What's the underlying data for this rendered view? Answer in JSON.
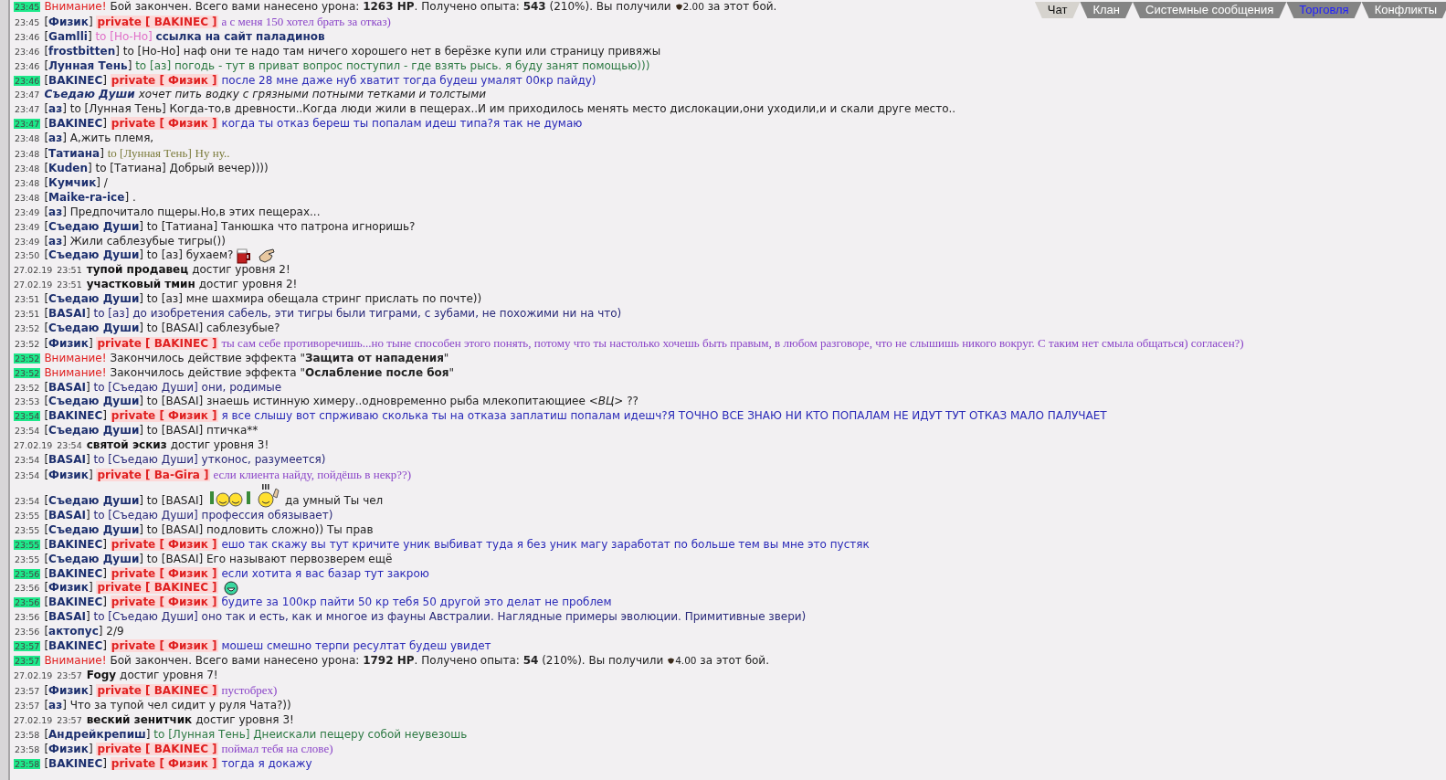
{
  "tabs": [
    {
      "label": "Чат",
      "selected": true,
      "unread": false
    },
    {
      "label": "Клан",
      "selected": false,
      "unread": false
    },
    {
      "label": "Системные сообщения",
      "selected": false,
      "unread": false
    },
    {
      "label": "Торговля",
      "selected": false,
      "unread": true
    },
    {
      "label": "Конфликты",
      "selected": false,
      "unread": false
    }
  ],
  "messages": [
    {
      "kind": "alert",
      "time": "23:45",
      "highlighted": true,
      "label": "Внимание!",
      "text": "Бой закончен. Всего вами нанесено урона: **1263 HP**. Получено опыта: **543** (210%). Вы получили",
      "amount": "2.00",
      "tail": "за этот бой."
    },
    {
      "kind": "private",
      "time": "23:45",
      "highlighted": false,
      "sender": "[**Физик**]",
      "to": "private [ BAKINEC ]",
      "ornate": true,
      "text": "а с меня 150 хотел брать за отказ)",
      "color": "#8a44c8"
    },
    {
      "kind": "chat",
      "time": "23:46",
      "highlighted": false,
      "sender": "[**Gamlli**]",
      "to": {
        "label": "to [Но-Но]",
        "color": "#e070c8"
      },
      "text": "**ссылка на сайт паладинов**",
      "color": "#1c2f6e"
    },
    {
      "kind": "chat",
      "time": "23:46",
      "highlighted": false,
      "sender": "[**frostbitten**]",
      "to": "to [Но-Но]",
      "text": "наф они те надо там ничего хорошего нет в берёзке купи или страницу привяжы",
      "color": "#222222"
    },
    {
      "kind": "chat",
      "time": "23:46",
      "highlighted": false,
      "sender": "[**Лунная Тень**]",
      "to": "to [аз]",
      "text": "погодь - тут в приват вопрос поступил - где взять рысь. я буду занят помощью)))",
      "color": "#2e7a44"
    },
    {
      "kind": "private",
      "time": "23:46",
      "highlighted": true,
      "sender": "[**BAKINEC**]",
      "to": "private [ Физик ]",
      "text": "после 28 мне даже нуб хватит тогда будеш умалят 00кр пайду)",
      "color": "#2a2ab8"
    },
    {
      "kind": "action",
      "time": "23:47",
      "highlighted": false,
      "name": "Съедаю Души",
      "text": "хочет пить водку с грязными потными тетками и толстыми"
    },
    {
      "kind": "chat",
      "time": "23:47",
      "highlighted": false,
      "sender": "[**аз**]",
      "to": "to [Лунная Тень]",
      "text": "Когда-то,в древности..Когда люди жили в пещерах..И им приходилось менять место дислокации,они уходили,и и скали друге место..",
      "color": "#222222"
    },
    {
      "kind": "private",
      "time": "23:47",
      "highlighted": true,
      "sender": "[**BAKINEC**]",
      "to": "private [ Физик ]",
      "text": "когда ты отказ береш ты попалам идеш типа?я так не думаю",
      "color": "#2a2ab8"
    },
    {
      "kind": "chat",
      "time": "23:48",
      "highlighted": false,
      "sender": "[**аз**]",
      "text": "А,жить племя,",
      "color": "#222222"
    },
    {
      "kind": "chat",
      "time": "23:48",
      "highlighted": false,
      "sender": "[**Татиана**]",
      "to": "to [Лунная Тень]",
      "ornate": true,
      "text": "Ну ну..",
      "color": "#7a7a3a"
    },
    {
      "kind": "chat",
      "time": "23:48",
      "highlighted": false,
      "sender": "[**Kuden**]",
      "to": "to [Татиана]",
      "text": "Добрый вечер))))",
      "color": "#222222"
    },
    {
      "kind": "chat",
      "time": "23:48",
      "highlighted": false,
      "sender": "[**Кумчик**]",
      "text": "/"
    },
    {
      "kind": "chat",
      "time": "23:48",
      "highlighted": false,
      "sender": "[**Maike-ra-ice**]",
      "text": "."
    },
    {
      "kind": "chat",
      "time": "23:49",
      "highlighted": false,
      "sender": "[**аз**]",
      "text": "Предпочитало пщеры.Но,в этих пещерах...",
      "color": "#222222"
    },
    {
      "kind": "chat",
      "time": "23:49",
      "highlighted": false,
      "sender": "[**Съедаю Души**]",
      "to": "to [Татиана]",
      "text": "Танюшка что патрона игноришь?",
      "color": "#222222"
    },
    {
      "kind": "chat",
      "time": "23:49",
      "highlighted": false,
      "sender": "[**аз**]",
      "text": "Жили саблезубые тигры())",
      "color": "#222222"
    },
    {
      "kind": "chat",
      "time": "23:50",
      "highlighted": false,
      "sender": "[**Съедаю Души**]",
      "to": "to [аз]",
      "text": "бухаем?",
      "color": "#222222",
      "emoticons": [
        {
          "kind": "mug"
        },
        {
          "kind": "hand"
        }
      ]
    },
    {
      "kind": "level",
      "date": "27.02.19",
      "time": "23:51",
      "highlighted": false,
      "name": "тупой продавец",
      "text": "достиг уровня 2!"
    },
    {
      "kind": "level",
      "date": "27.02.19",
      "time": "23:51",
      "highlighted": false,
      "name": "участковый тмин",
      "text": "достиг уровня 2!"
    },
    {
      "kind": "chat",
      "time": "23:51",
      "highlighted": false,
      "sender": "[**Съедаю Души**]",
      "to": "to [аз]",
      "text": "мне шахмира обещала стринг прислать по почте))",
      "color": "#222222"
    },
    {
      "kind": "chat",
      "time": "23:51",
      "highlighted": false,
      "sender": "[**BASAI**]",
      "to": "to [аз]",
      "text": "до изобретения сабель, эти тигры были тиграми, с зубами, не похожими ни на что)",
      "color": "#2a2a7a"
    },
    {
      "kind": "chat",
      "time": "23:52",
      "highlighted": false,
      "sender": "[**Съедаю Души**]",
      "to": "to [BASAI]",
      "text": "саблезубые?",
      "color": "#222222"
    },
    {
      "kind": "private",
      "time": "23:52",
      "highlighted": false,
      "sender": "[**Физик**]",
      "to": "private [ BAKINEC ]",
      "ornate": true,
      "text": "ты сам себе противоречишь...но тыне способен этого понять, потому что ты настолько хочешь быть правым, в любом разговоре, что не слышишь никого вокруг. С таким нет смыла общаться) согласен?)",
      "color": "#8a44c8"
    },
    {
      "kind": "alert",
      "time": "23:52",
      "highlighted": true,
      "label": "Внимание!",
      "text": "Закончилось действие эффекта \"**Защита от нападения**\""
    },
    {
      "kind": "alert",
      "time": "23:52",
      "highlighted": true,
      "label": "Внимание!",
      "text": "Закончилось действие эффекта \"**Ослабление после боя**\""
    },
    {
      "kind": "chat",
      "time": "23:52",
      "highlighted": false,
      "sender": "[**BASAI**]",
      "to": "to [Съедаю Души]",
      "text": "они, родимые",
      "color": "#2a2a7a"
    },
    {
      "kind": "chat",
      "time": "23:53",
      "highlighted": false,
      "sender": "[**Съедаю Души**]",
      "to": "to [BASAI]",
      "text": "знаешь истинную химеру..одновременно рыба млекопитающиее *<ВЦ>* ??",
      "color": "#222222"
    },
    {
      "kind": "private",
      "time": "23:54",
      "highlighted": true,
      "sender": "[**BAKINEC**]",
      "to": "private [ Физик ]",
      "text": "я все слышу вот спрживаю сколька ты на отказа заплатиш попалам идешч?Я ТОЧНО ВСЕ ЗНАЮ НИ КТО ПОПАЛАМ НЕ ИДУТ ТУТ ОТКАЗ МАЛО ПАЛУЧАЕТ",
      "color": "#2a2ab8"
    },
    {
      "kind": "chat",
      "time": "23:54",
      "highlighted": false,
      "sender": "[**Съедаю Души**]",
      "to": "to [BASAI]",
      "text": "птичка**",
      "color": "#222222"
    },
    {
      "kind": "level",
      "date": "27.02.19",
      "time": "23:54",
      "highlighted": false,
      "name": "святой эскиз",
      "text": "достиг уровня 3!"
    },
    {
      "kind": "chat",
      "time": "23:54",
      "highlighted": false,
      "sender": "[**BASAI**]",
      "to": "to [Съедаю Души]",
      "text": "утконос, разумеется)",
      "color": "#2a2a7a"
    },
    {
      "kind": "private",
      "time": "23:54",
      "highlighted": false,
      "sender": "[**Физик**]",
      "to": "private [ Ba-Gira ]",
      "ornate": true,
      "text": "если клиента найду, пойдёшь в некр??)",
      "color": "#8a44c8"
    },
    {
      "kind": "chat",
      "time": "23:54",
      "highlighted": false,
      "sender": "[**Съедаю Души**]",
      "to": "to [BASAI]",
      "emoticons_before": [
        {
          "kind": "party"
        },
        {
          "kind": "cheer"
        }
      ],
      "text": "да умный Ты чел",
      "color": "#222222"
    },
    {
      "kind": "chat",
      "time": "23:55",
      "highlighted": false,
      "sender": "[**BASAI**]",
      "to": "to [Съедаю Души]",
      "text": "профессия обязывает)",
      "color": "#2a2a7a"
    },
    {
      "kind": "chat",
      "time": "23:55",
      "highlighted": false,
      "sender": "[**Съедаю Души**]",
      "to": "to [BASAI]",
      "text": "подловить сложно)) Ты прав",
      "color": "#222222"
    },
    {
      "kind": "private",
      "time": "23:55",
      "highlighted": true,
      "sender": "[**BAKINEC**]",
      "to": "private [ Физик ]",
      "text": "ешо так скажу вы тут кричите уник выбиват туда я без уник магу заработат по больше тем вы мне это пустяк",
      "color": "#2a2ab8"
    },
    {
      "kind": "chat",
      "time": "23:55",
      "highlighted": false,
      "sender": "[**Съедаю Души**]",
      "to": "to [BASAI]",
      "text": "Его называют первозверем ещё",
      "color": "#222222"
    },
    {
      "kind": "private",
      "time": "23:56",
      "highlighted": true,
      "sender": "[**BAKINEC**]",
      "to": "private [ Физик ]",
      "text": "если хотита я вас базар тут закрою",
      "color": "#2a2ab8"
    },
    {
      "kind": "private",
      "time": "23:56",
      "highlighted": false,
      "sender": "[**Физик**]",
      "to": "private [ BAKINEC ]",
      "emoticons": [
        {
          "kind": "grin"
        }
      ]
    },
    {
      "kind": "private",
      "time": "23:56",
      "highlighted": true,
      "sender": "[**BAKINEC**]",
      "to": "private [ Физик ]",
      "text": "будите за 100кр пайти 50 кр тебя 50 другой это делат не проблем",
      "color": "#2a2ab8"
    },
    {
      "kind": "chat",
      "time": "23:56",
      "highlighted": false,
      "sender": "[**BASAI**]",
      "to": "to [Съедаю Души]",
      "text": "оно так и есть, как и многое из фауны Австралии. Наглядные примеры эволюции. Примитивные звери)",
      "color": "#2a2a7a"
    },
    {
      "kind": "chat",
      "time": "23:56",
      "highlighted": false,
      "sender": "[**актопус**]",
      "text": "2/9",
      "color": "#222222"
    },
    {
      "kind": "private",
      "time": "23:57",
      "highlighted": true,
      "sender": "[**BAKINEC**]",
      "to": "private [ Физик ]",
      "text": "мошеш смешно терпи ресултат будеш увидет",
      "color": "#2a2ab8"
    },
    {
      "kind": "alert",
      "time": "23:57",
      "highlighted": true,
      "label": "Внимание!",
      "text": "Бой закончен. Всего вами нанесено урона: **1792 HP**. Получено опыта: **54** (210%). Вы получили",
      "amount": "4.00",
      "tail": "за этот бой."
    },
    {
      "kind": "level",
      "date": "27.02.19",
      "time": "23:57",
      "highlighted": false,
      "name": "Fogy",
      "text": "достиг уровня 7!"
    },
    {
      "kind": "private",
      "time": "23:57",
      "highlighted": false,
      "sender": "[**Физик**]",
      "to": "private [ BAKINEC ]",
      "ornate": true,
      "text": "пустобрех)",
      "color": "#8a44c8"
    },
    {
      "kind": "chat",
      "time": "23:57",
      "highlighted": false,
      "sender": "[**аз**]",
      "text": "Что за тупой чел сидит у руля Чата?))",
      "color": "#222222"
    },
    {
      "kind": "level",
      "date": "27.02.19",
      "time": "23:57",
      "highlighted": false,
      "name": "веский зенитчик",
      "text": "достиг уровня 3!"
    },
    {
      "kind": "chat",
      "time": "23:58",
      "highlighted": false,
      "sender": "[**Андрейкрепиш**]",
      "to": "to [Лунная Тень]",
      "text": "Днеискали пещеру собой неувезошь",
      "color": "#2e7a44"
    },
    {
      "kind": "private",
      "time": "23:58",
      "highlighted": false,
      "sender": "[**Физик**]",
      "to": "private [ BAKINEC ]",
      "ornate": true,
      "text": "поймал тебя на слове)",
      "color": "#8a44c8"
    },
    {
      "kind": "private",
      "time": "23:58",
      "highlighted": true,
      "sender": "[**BAKINEC**]",
      "to": "private [ Физик ]",
      "text": "тогда я докажу",
      "color": "#2a2ab8"
    }
  ]
}
